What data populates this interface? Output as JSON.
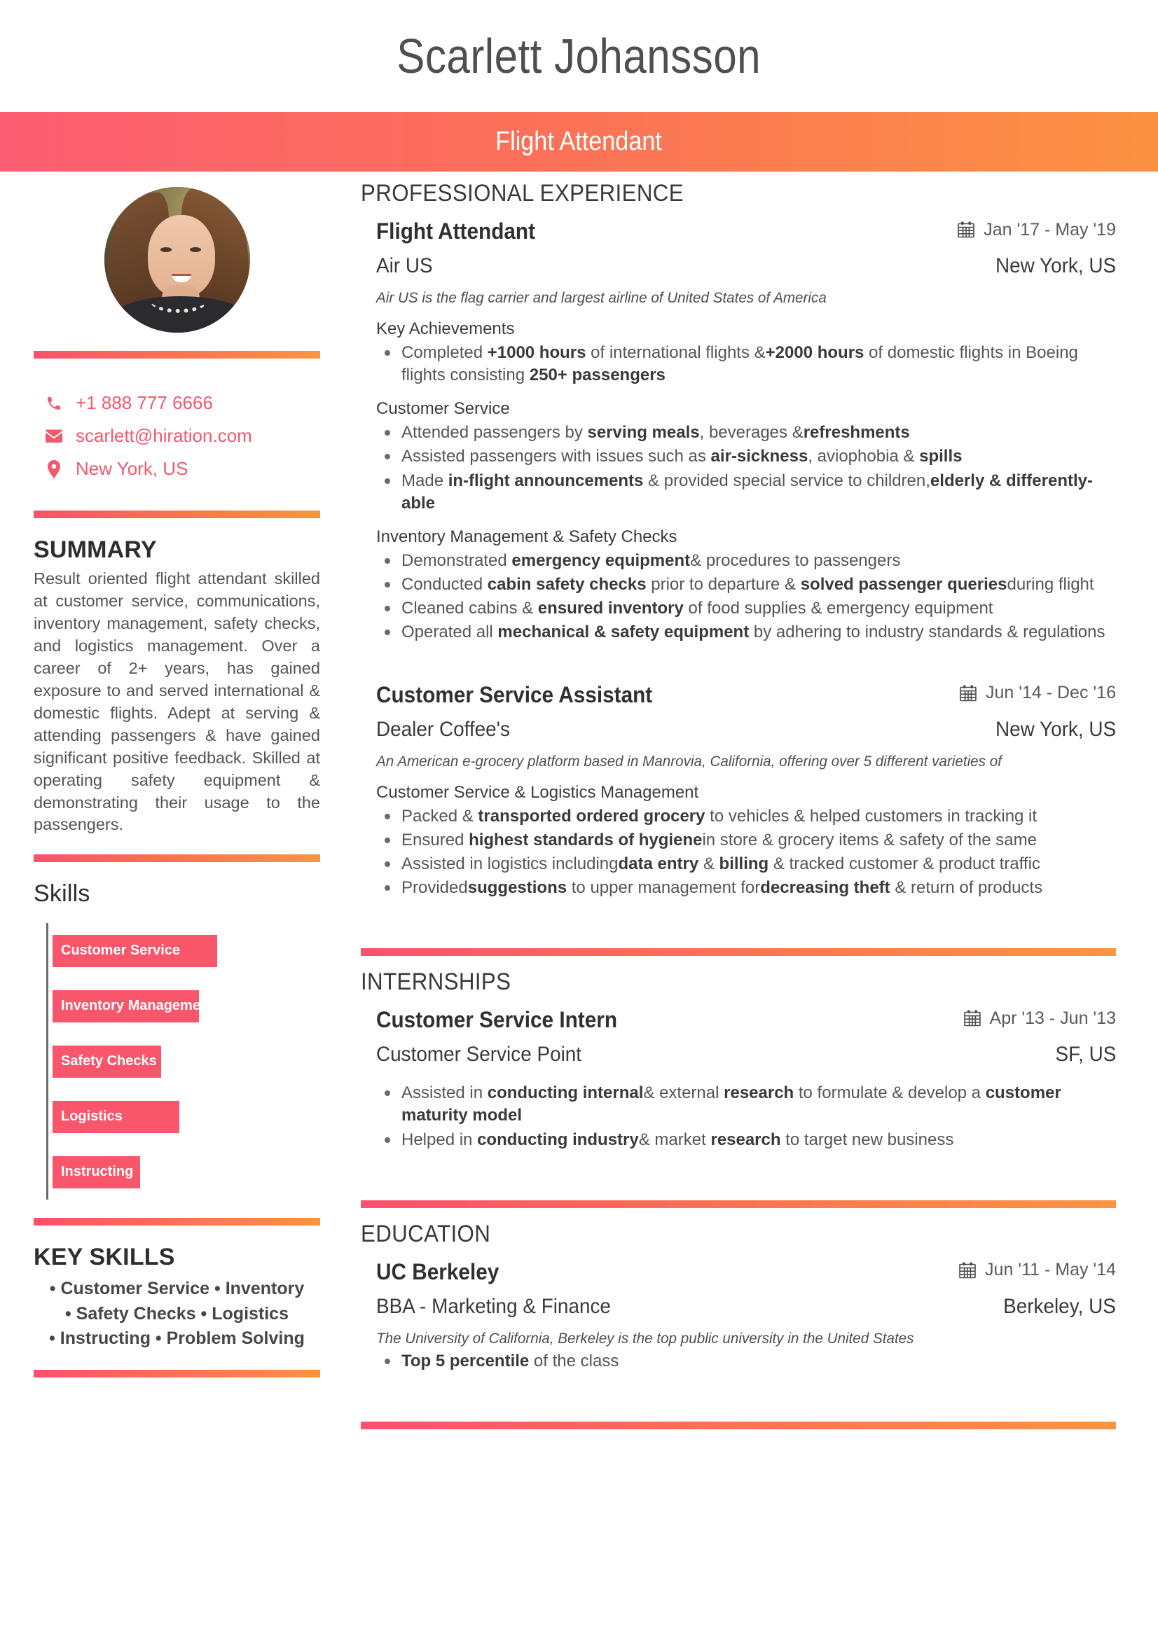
{
  "header": {
    "full_name": "Scarlett Johansson",
    "job_title": "Flight Attendant",
    "accent_start": "#fb5d72",
    "accent_end": "#fb9242"
  },
  "sidebar": {
    "avatar_alt": "profile-photo",
    "contact": [
      {
        "icon": "phone-icon",
        "value": "+1 888 777 6666"
      },
      {
        "icon": "envelope-icon",
        "value": "scarlett@hiration.com"
      },
      {
        "icon": "location-pin-icon",
        "value": "New York, US"
      }
    ],
    "summary": {
      "heading": "SUMMARY",
      "text": "Result oriented flight attendant skilled at customer service, communications, inventory management, safety checks, and logistics management. Over a career of 2+ years, has gained exposure to and served international & domestic flights. Adept at serving & attending passengers & have gained significant positive feedback. Skilled at operating safety equipment & demonstrating their usage to the passengers."
    },
    "skills": {
      "heading": "Skills"
    },
    "key_skills": {
      "heading": "KEY SKILLS",
      "lines": [
        "• Customer Service • Inventory",
        "• Safety Checks • Logistics",
        "• Instructing • Problem Solving"
      ]
    }
  },
  "chart_data": {
    "type": "bar",
    "orientation": "horizontal",
    "title": "Skills",
    "categories": [
      "Customer Service",
      "Inventory Management",
      "Safety Checks",
      "Logistics",
      "Instructing"
    ],
    "values": [
      100,
      89,
      66,
      77,
      53
    ],
    "bar_color": "#f9556b",
    "axis_color": "#6a6a6a",
    "xlabel": "",
    "ylabel": "",
    "xlim": [
      0,
      100
    ],
    "grid": false,
    "legend": "none",
    "data_labels_inside_bars": true
  },
  "main": {
    "experience": {
      "heading": "PROFESSIONAL EXPERIENCE",
      "entries": [
        {
          "role": "Flight Attendant",
          "dates": "Jan '17 -  May '19",
          "org": "Air US",
          "location": "New York, US",
          "blurb": "Air US is the flag carrier and largest airline of United States of America",
          "groups": [
            {
              "sub_heading": "Key Achievements",
              "bullets": [
                "Completed <b>+1000 hours</b> of international flights &<b>+2000 hours</b> of domestic flights in Boeing flights consisting <b>250+ passengers</b>"
              ]
            },
            {
              "sub_heading": "Customer Service",
              "bullets": [
                "Attended passengers by <b>serving meals</b>, beverages &<b>refreshments</b>",
                "Assisted passengers with issues such as <b>air-sickness</b>, aviophobia &amp; <b>spills</b>",
                "Made <b>in-flight announcements</b> &amp; provided special service to children,<b>elderly &amp; differently-able</b>"
              ]
            },
            {
              "sub_heading": "Inventory Management &amp; Safety Checks",
              "bullets": [
                "Demonstrated <b>emergency equipment</b>&amp; procedures to passengers",
                "Conducted <b>cabin safety checks</b> prior to departure &amp; <b>solved passenger queries</b>during flight",
                "Cleaned cabins &amp; <b>ensured inventory</b> of food supplies &amp; emergency equipment",
                "Operated all <b>mechanical &amp; safety equipment</b> by adhering to industry standards &amp; regulations"
              ]
            }
          ]
        },
        {
          "role": "Customer Service Assistant",
          "dates": "Jun '14 -  Dec '16",
          "org": "Dealer Coffee's",
          "location": "New York, US",
          "blurb": "An American e-grocery platform based in Manrovia, California, offering over 5 different varieties of",
          "groups": [
            {
              "sub_heading": "Customer Service &amp; Logistics Management",
              "bullets": [
                "Packed &amp; <b>transported ordered grocery</b> to vehicles &amp; helped customers in tracking it",
                "Ensured <b>highest standards of hygiene</b>in store &amp; grocery items &amp; safety of the same",
                "Assisted in logistics including<b>data entry</b> &amp; <b>billing</b> &amp; tracked customer &amp; product traffic",
                "Provided<b>suggestions</b> to upper management for<b>decreasing theft</b> &amp; return of products"
              ]
            }
          ]
        }
      ]
    },
    "internships": {
      "heading": "INTERNSHIPS",
      "entries": [
        {
          "role": "Customer Service Intern",
          "dates": "Apr '13 -  Jun '13",
          "org": "Customer Service Point",
          "location": "SF, US",
          "blurb": "",
          "groups": [
            {
              "sub_heading": "",
              "bullets": [
                "Assisted in <b>conducting internal</b>&amp; external <b>research</b> to formulate &amp; develop a <b>customer maturity model</b>",
                "Helped in <b>conducting industry</b>&amp; market <b>research</b> to target new business"
              ]
            }
          ]
        }
      ]
    },
    "education": {
      "heading": "EDUCATION",
      "entries": [
        {
          "role": "UC Berkeley",
          "dates": "Jun '11 -  May '14",
          "org": "BBA - Marketing &amp; Finance",
          "location": "Berkeley, US",
          "blurb": "The University of California, Berkeley is the top public university in the United States",
          "groups": [
            {
              "sub_heading": "",
              "bullets": [
                "<b>Top 5 percentile</b> of the class"
              ]
            }
          ]
        }
      ]
    }
  }
}
